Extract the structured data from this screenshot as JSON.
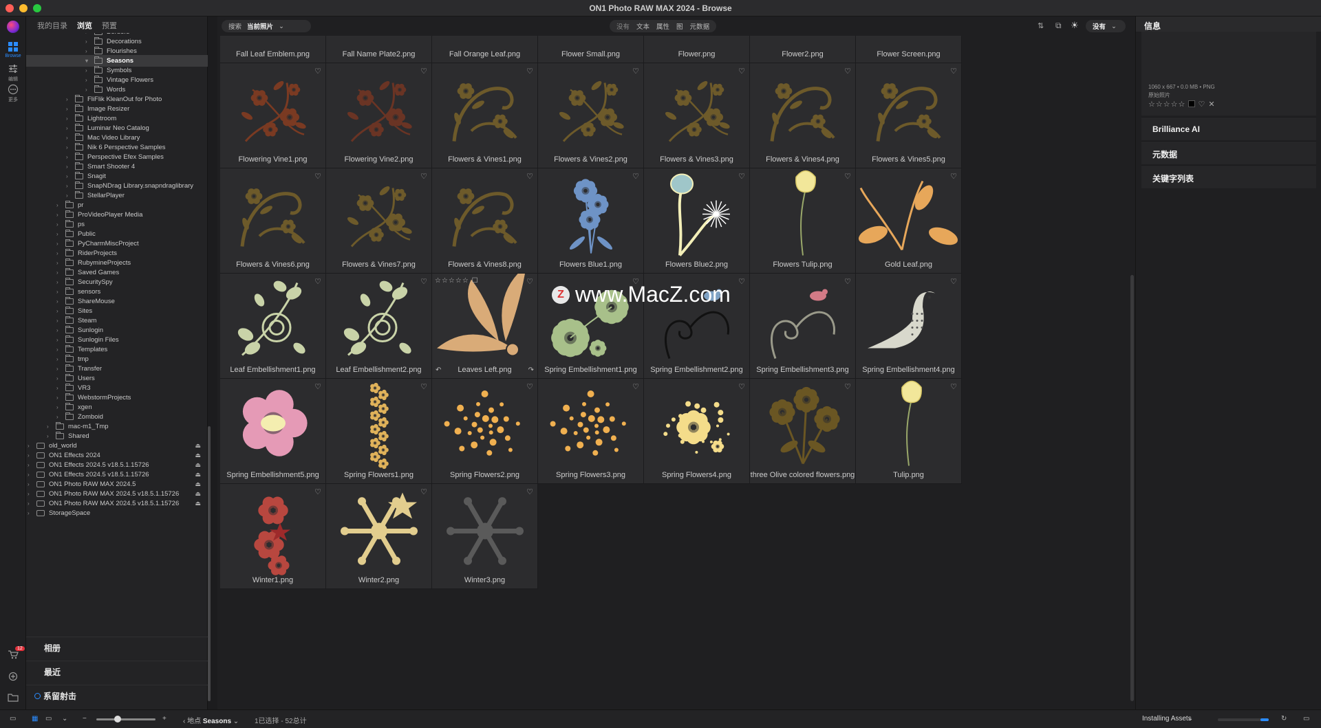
{
  "window": {
    "title": "ON1 Photo RAW MAX 2024 - Browse"
  },
  "leftbar": {
    "items": [
      {
        "icon": "grid-icon",
        "label": "Browse",
        "active": true
      },
      {
        "icon": "sliders-icon",
        "label": "编辑",
        "active": false
      },
      {
        "icon": "more-icon",
        "label": "更多",
        "active": false
      }
    ],
    "bottom_badge": "12"
  },
  "sidebar": {
    "tabs": [
      "我的目录",
      "浏览",
      "预置"
    ],
    "active_tab": "浏览",
    "tree": [
      {
        "label": "Borders",
        "depth": 6,
        "type": "folder"
      },
      {
        "label": "Decorations",
        "depth": 6,
        "type": "folder"
      },
      {
        "label": "Flourishes",
        "depth": 6,
        "type": "folder"
      },
      {
        "label": "Seasons",
        "depth": 6,
        "type": "folder",
        "selected": true,
        "open": true
      },
      {
        "label": "Symbols",
        "depth": 6,
        "type": "folder"
      },
      {
        "label": "Vintage Flowers",
        "depth": 6,
        "type": "folder"
      },
      {
        "label": "Words",
        "depth": 6,
        "type": "folder"
      },
      {
        "label": "FliFlik KleanOut for Photo",
        "depth": 4,
        "type": "folder"
      },
      {
        "label": "Image Resizer",
        "depth": 4,
        "type": "folder"
      },
      {
        "label": "Lightroom",
        "depth": 4,
        "type": "folder"
      },
      {
        "label": "Luminar Neo Catalog",
        "depth": 4,
        "type": "folder"
      },
      {
        "label": "Mac Video Library",
        "depth": 4,
        "type": "folder"
      },
      {
        "label": "Nik 6 Perspective Samples",
        "depth": 4,
        "type": "folder"
      },
      {
        "label": "Perspective Efex Samples",
        "depth": 4,
        "type": "folder"
      },
      {
        "label": "Smart Shooter 4",
        "depth": 4,
        "type": "folder"
      },
      {
        "label": "Snagit",
        "depth": 4,
        "type": "folder"
      },
      {
        "label": "SnapNDrag Library.snapndraglibrary",
        "depth": 4,
        "type": "folder"
      },
      {
        "label": "StellarPlayer",
        "depth": 4,
        "type": "folder"
      },
      {
        "label": "pr",
        "depth": 3,
        "type": "folder"
      },
      {
        "label": "ProVideoPlayer Media",
        "depth": 3,
        "type": "folder"
      },
      {
        "label": "ps",
        "depth": 3,
        "type": "folder"
      },
      {
        "label": "Public",
        "depth": 3,
        "type": "folder"
      },
      {
        "label": "PyCharmMiscProject",
        "depth": 3,
        "type": "folder"
      },
      {
        "label": "RiderProjects",
        "depth": 3,
        "type": "folder"
      },
      {
        "label": "RubymineProjects",
        "depth": 3,
        "type": "folder"
      },
      {
        "label": "Saved Games",
        "depth": 3,
        "type": "folder"
      },
      {
        "label": "SecuritySpy",
        "depth": 3,
        "type": "folder"
      },
      {
        "label": "sensors",
        "depth": 3,
        "type": "folder"
      },
      {
        "label": "ShareMouse",
        "depth": 3,
        "type": "folder"
      },
      {
        "label": "Sites",
        "depth": 3,
        "type": "folder"
      },
      {
        "label": "Steam",
        "depth": 3,
        "type": "folder"
      },
      {
        "label": "Sunlogin",
        "depth": 3,
        "type": "folder"
      },
      {
        "label": "Sunlogin Files",
        "depth": 3,
        "type": "folder"
      },
      {
        "label": "Templates",
        "depth": 3,
        "type": "folder"
      },
      {
        "label": "tmp",
        "depth": 3,
        "type": "folder"
      },
      {
        "label": "Transfer",
        "depth": 3,
        "type": "folder"
      },
      {
        "label": "Users",
        "depth": 3,
        "type": "folder"
      },
      {
        "label": "VR3",
        "depth": 3,
        "type": "folder"
      },
      {
        "label": "WebstormProjects",
        "depth": 3,
        "type": "folder"
      },
      {
        "label": "xgen",
        "depth": 3,
        "type": "folder"
      },
      {
        "label": "Zomboid",
        "depth": 3,
        "type": "folder"
      },
      {
        "label": "mac-m1_Tmp",
        "depth": 2,
        "type": "folder"
      },
      {
        "label": "Shared",
        "depth": 2,
        "type": "folder"
      },
      {
        "label": "old_world",
        "depth": 0,
        "type": "drive",
        "eject": true
      },
      {
        "label": "ON1 Effects 2024",
        "depth": 0,
        "type": "drive",
        "eject": true
      },
      {
        "label": "ON1 Effects 2024.5 v18.5.1.15726",
        "depth": 0,
        "type": "drive",
        "eject": true
      },
      {
        "label": "ON1 Effects 2024.5 v18.5.1.15726",
        "depth": 0,
        "type": "drive",
        "eject": true
      },
      {
        "label": "ON1 Photo RAW MAX 2024.5",
        "depth": 0,
        "type": "drive",
        "eject": true
      },
      {
        "label": "ON1 Photo RAW MAX 2024.5 v18.5.1.15726",
        "depth": 0,
        "type": "drive",
        "eject": true
      },
      {
        "label": "ON1 Photo RAW MAX 2024.5 v18.5.1.15726",
        "depth": 0,
        "type": "drive",
        "eject": true
      },
      {
        "label": "StorageSpace",
        "depth": 0,
        "type": "drive",
        "eject": false
      }
    ],
    "sections": [
      {
        "label": "相册"
      },
      {
        "label": "最近"
      },
      {
        "label": "系留射击"
      }
    ]
  },
  "topbar": {
    "search_label": "搜索",
    "search_scope": "当前照片",
    "filter_options": [
      "没有",
      "文本",
      "属性",
      "图",
      "元数据"
    ],
    "sort_value": "没有"
  },
  "watermark": "www.MacZ.com",
  "thumbnails": [
    {
      "name": "Fall Leaf Emblem.png"
    },
    {
      "name": "Fall Name Plate2.png"
    },
    {
      "name": "Fall Orange Leaf.png"
    },
    {
      "name": "Flower Small.png"
    },
    {
      "name": "Flower.png"
    },
    {
      "name": "Flower2.png"
    },
    {
      "name": "Flower Screen.png"
    },
    {
      "name": "Flowering Vine1.png",
      "art": "vine",
      "color": "#7a3a22"
    },
    {
      "name": "Flowering Vine2.png",
      "art": "vine",
      "color": "#6a3424"
    },
    {
      "name": "Flowers & Vines1.png",
      "art": "swirl",
      "color": "#6d5a2a"
    },
    {
      "name": "Flowers & Vines2.png",
      "art": "vine",
      "color": "#6d5a2a"
    },
    {
      "name": "Flowers & Vines3.png",
      "art": "vine",
      "color": "#6d5a2a"
    },
    {
      "name": "Flowers & Vines4.png",
      "art": "swirl",
      "color": "#6d5a2a"
    },
    {
      "name": "Flowers & Vines5.png",
      "art": "swirl",
      "color": "#6d5a2a"
    },
    {
      "name": "Flowers & Vines6.png",
      "art": "swirl",
      "color": "#6d5a2a"
    },
    {
      "name": "Flowers & Vines7.png",
      "art": "vine",
      "color": "#6d5a2a"
    },
    {
      "name": "Flowers & Vines8.png",
      "art": "swirl",
      "color": "#6d5a2a"
    },
    {
      "name": "Flowers Blue1.png",
      "art": "blue",
      "color": "#6e93c6"
    },
    {
      "name": "Flowers Blue2.png",
      "art": "tulipblue",
      "color": "#9fc6c9"
    },
    {
      "name": "Flowers Tulip.png",
      "art": "tulip",
      "color": "#f2e79a"
    },
    {
      "name": "Gold Leaf.png",
      "art": "goldleaf",
      "color": "#e7a75a"
    },
    {
      "name": "Leaf Embellishment1.png",
      "art": "emb",
      "color": "#c9d3a8"
    },
    {
      "name": "Leaf Embellishment2.png",
      "art": "emb",
      "color": "#c9d3a8"
    },
    {
      "name": "Leaves Left.png",
      "art": "leaves",
      "color": "#d9ab78",
      "selected": true
    },
    {
      "name": "Spring Embellishment1.png",
      "art": "burst",
      "color": "#a8c08a"
    },
    {
      "name": "Spring Embellishment2.png",
      "art": "bird",
      "color": "#111111"
    },
    {
      "name": "Spring Embellishment3.png",
      "art": "bird",
      "color": "#9a9a8a"
    },
    {
      "name": "Spring Embellishment4.png",
      "art": "dove",
      "color": "#d8d8cc"
    },
    {
      "name": "Spring Embellishment5.png",
      "art": "pink",
      "color": "#e59ab6"
    },
    {
      "name": "Spring Flowers1.png",
      "art": "column",
      "color": "#e0b25a"
    },
    {
      "name": "Spring Flowers2.png",
      "art": "dots",
      "color": "#f0b050"
    },
    {
      "name": "Spring Flowers3.png",
      "art": "dots",
      "color": "#f0b050"
    },
    {
      "name": "Spring Flowers4.png",
      "art": "cream",
      "color": "#f4dc8a"
    },
    {
      "name": "three Olive colored flowers.png",
      "art": "olive",
      "color": "#6a5623"
    },
    {
      "name": "Tulip.png",
      "art": "tulip",
      "color": "#f2e79a"
    },
    {
      "name": "Winter1.png",
      "art": "winter1",
      "color": "#b8473f"
    },
    {
      "name": "Winter2.png",
      "art": "flake",
      "color": "#e2cd8e"
    },
    {
      "name": "Winter3.png",
      "art": "flake",
      "color": "#5a5a5a"
    }
  ],
  "rightpanel": {
    "title": "信息",
    "meta": "1060 x 667 • 0.0 MB • PNG",
    "meta2": "原始照片",
    "sections": [
      "Brilliance AI",
      "元数据",
      "关键字列表"
    ]
  },
  "statusbar": {
    "location_label": "地点",
    "location_value": "Seasons",
    "selection": "1已选择 - 52总计",
    "task": "Installing Assets"
  },
  "colors": {
    "accent": "#2b8cff",
    "cell_bg": "#2c2c2e",
    "panel_bg": "#232325"
  }
}
